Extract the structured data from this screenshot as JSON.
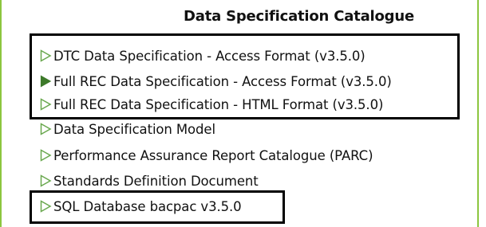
{
  "catalogue": {
    "title": "Data Specification Catalogue",
    "accent_color": "#6aa84f",
    "items": [
      {
        "label": "DTC Data Specification - Access Format (v3.5.0)",
        "icon": "triangle-right-outline-icon"
      },
      {
        "label": "Full REC Data Specification - Access Format (v3.5.0)",
        "icon": "triangle-right-filled-icon"
      },
      {
        "label": "Full REC Data Specification - HTML Format (v3.5.0)",
        "icon": "triangle-right-outline-icon"
      },
      {
        "label": "Data Specification Model",
        "icon": "triangle-right-outline-icon"
      },
      {
        "label": "Performance Assurance Report Catalogue (PARC)",
        "icon": "triangle-right-outline-icon"
      },
      {
        "label": "Standards Definition Document",
        "icon": "triangle-right-outline-icon"
      },
      {
        "label": "SQL Database bacpac v3.5.0",
        "icon": "triangle-right-outline-icon"
      }
    ]
  }
}
